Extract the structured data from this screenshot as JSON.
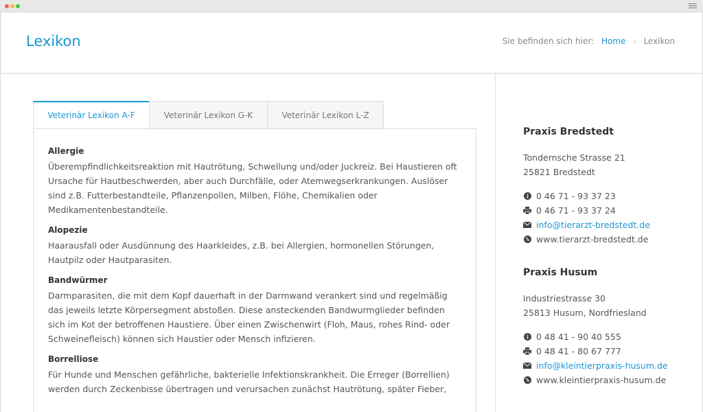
{
  "page": {
    "title": "Lexikon"
  },
  "breadcrumb": {
    "prefix": "Sie befinden sich hier:",
    "home": "Home",
    "separator": "›",
    "current": "Lexikon"
  },
  "tabs": [
    {
      "label": "Veterinär Lexikon A-F",
      "active": true
    },
    {
      "label": "Veterinär Lexikon G-K",
      "active": false
    },
    {
      "label": "Veterinär Lexikon L-Z",
      "active": false
    }
  ],
  "entries": [
    {
      "term": "Allergie",
      "definition": "Überempfindlichkeitsreaktion mit Hautrötung, Schwellung und/oder Juckreiz. Bei Haustieren oft Ursache für Hautbeschwerden, aber auch Durchfälle, oder Atemwegserkrankungen. Auslöser sind z.B. Futterbestandteile, Pflanzenpollen, Milben, Flöhe, Chemikalien oder Medikamentenbestandteile."
    },
    {
      "term": "Alopezie",
      "definition": "Haarausfall oder Ausdünnung des Haarkleides, z.B. bei Allergien, hormonellen Störungen, Hautpilz oder Hautparasiten."
    },
    {
      "term": "Bandwürmer",
      "definition": "Darmparasiten, die mit dem Kopf dauerhaft in der Darmwand verankert sind und regelmäßig das jeweils letzte Körpersegment abstoßen. Diese ansteckenden Bandwurmglieder befinden sich im Kot der betroffenen Haustiere. Über einen Zwischenwirt (Floh, Maus, rohes Rind- oder Schweinefleisch) können sich Haustier oder Mensch infizieren."
    },
    {
      "term": "Borrelliose",
      "definition": "Für Hunde und Menschen gefährliche, bakterielle Infektionskrankheit. Die Erreger (Borrellien) werden durch Zeckenbisse übertragen und verursachen zunächst Hautrötung, später Fieber,"
    }
  ],
  "practices": [
    {
      "name": "Praxis Bredstedt",
      "street": "Tondernsche Strasse 21",
      "city": "25821 Bredstedt",
      "phone": "0 46 71 - 93 37 23",
      "fax": "0 46 71 - 93 37 24",
      "email": "info@tierarzt-bredstedt.de",
      "web": "www.tierarzt-bredstedt.de"
    },
    {
      "name": "Praxis Husum",
      "street": "Industriestrasse 30",
      "city": "25813 Husum, Nordfriesland",
      "phone": "0 48 41 - 90 40 555",
      "fax": "0 48 41 - 80 67 777",
      "email": "info@kleintierpraxis-husum.de",
      "web": "www.kleintierpraxis-husum.de"
    }
  ],
  "icons": {
    "phone": "info-icon",
    "fax": "printer-icon",
    "email": "envelope-icon",
    "web": "globe-icon"
  },
  "colors": {
    "accent": "#1a96d4",
    "text": "#555555",
    "heading": "#333333"
  }
}
